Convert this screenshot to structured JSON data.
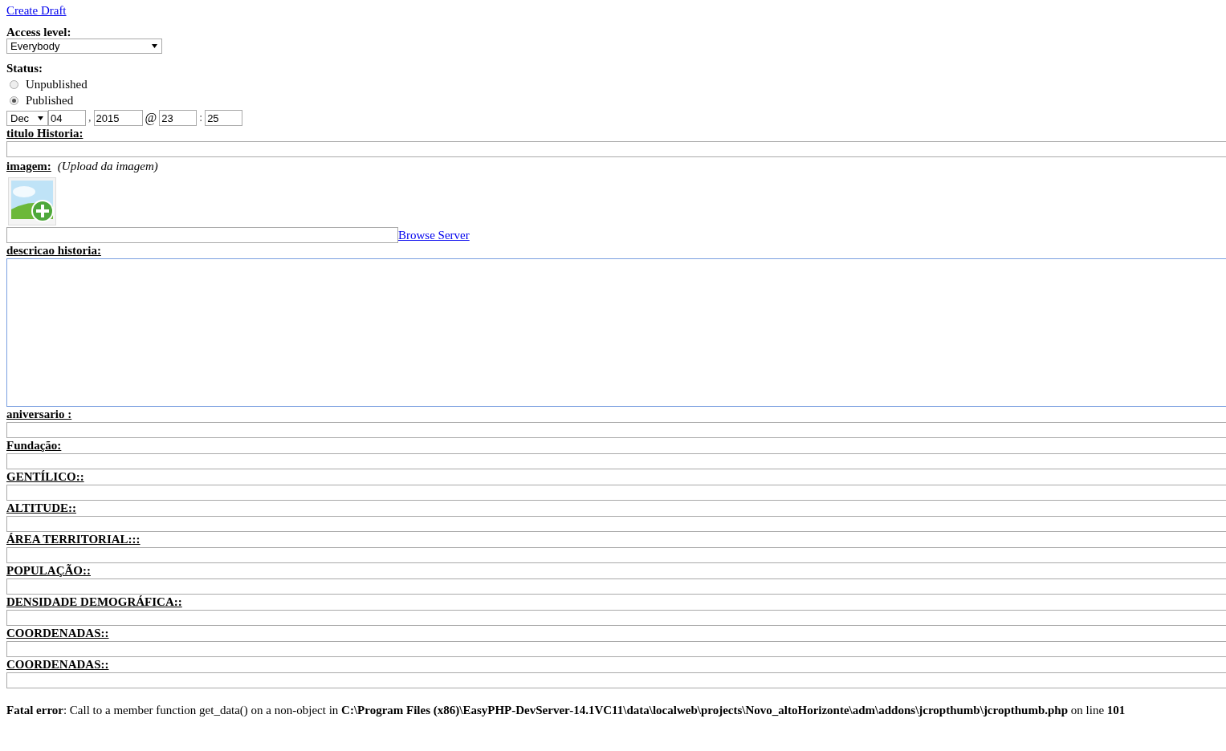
{
  "create_draft_link": "Create Draft",
  "access_level": {
    "label": "Access level:",
    "value": "Everybody"
  },
  "status": {
    "label": "Status:",
    "options": [
      {
        "label": "Unpublished",
        "selected": false
      },
      {
        "label": "Published",
        "selected": true
      }
    ]
  },
  "date": {
    "month": "Dec",
    "day": "04",
    "sep1": ",",
    "year": "2015",
    "at": "@",
    "hour": "23",
    "sep2": ":",
    "minute": "25"
  },
  "fields": [
    {
      "kind": "text",
      "label": "titulo Historia:"
    },
    {
      "kind": "image",
      "label": "imagem:",
      "hint": "(Upload da imagem)",
      "link": "Browse Server"
    },
    {
      "kind": "textarea",
      "label": "descricao historia:"
    },
    {
      "kind": "text",
      "label": "aniversario :"
    },
    {
      "kind": "text",
      "label": "Fundação:"
    },
    {
      "kind": "text",
      "label": "GENTÍLICO::"
    },
    {
      "kind": "text",
      "label": "ALTITUDE::"
    },
    {
      "kind": "text",
      "label": "ÁREA TERRITORIAL:::"
    },
    {
      "kind": "text",
      "label": "POPULAÇÃO::"
    },
    {
      "kind": "text",
      "label": "DENSIDADE DEMOGRÁFICA::"
    },
    {
      "kind": "text",
      "label": "COORDENADAS::"
    },
    {
      "kind": "text",
      "label": "COORDENADAS::"
    }
  ],
  "error": "**Fatal error**: Call to a member function get_data() on a non-object in **C:\\Program Files (x86)\\EasyPHP-DevServer-14.1VC11\\data\\localweb\\projects\\Novo_altoHorizonte\\adm\\addons\\jcropthumb\\jcropthumb.php** on line **101**"
}
